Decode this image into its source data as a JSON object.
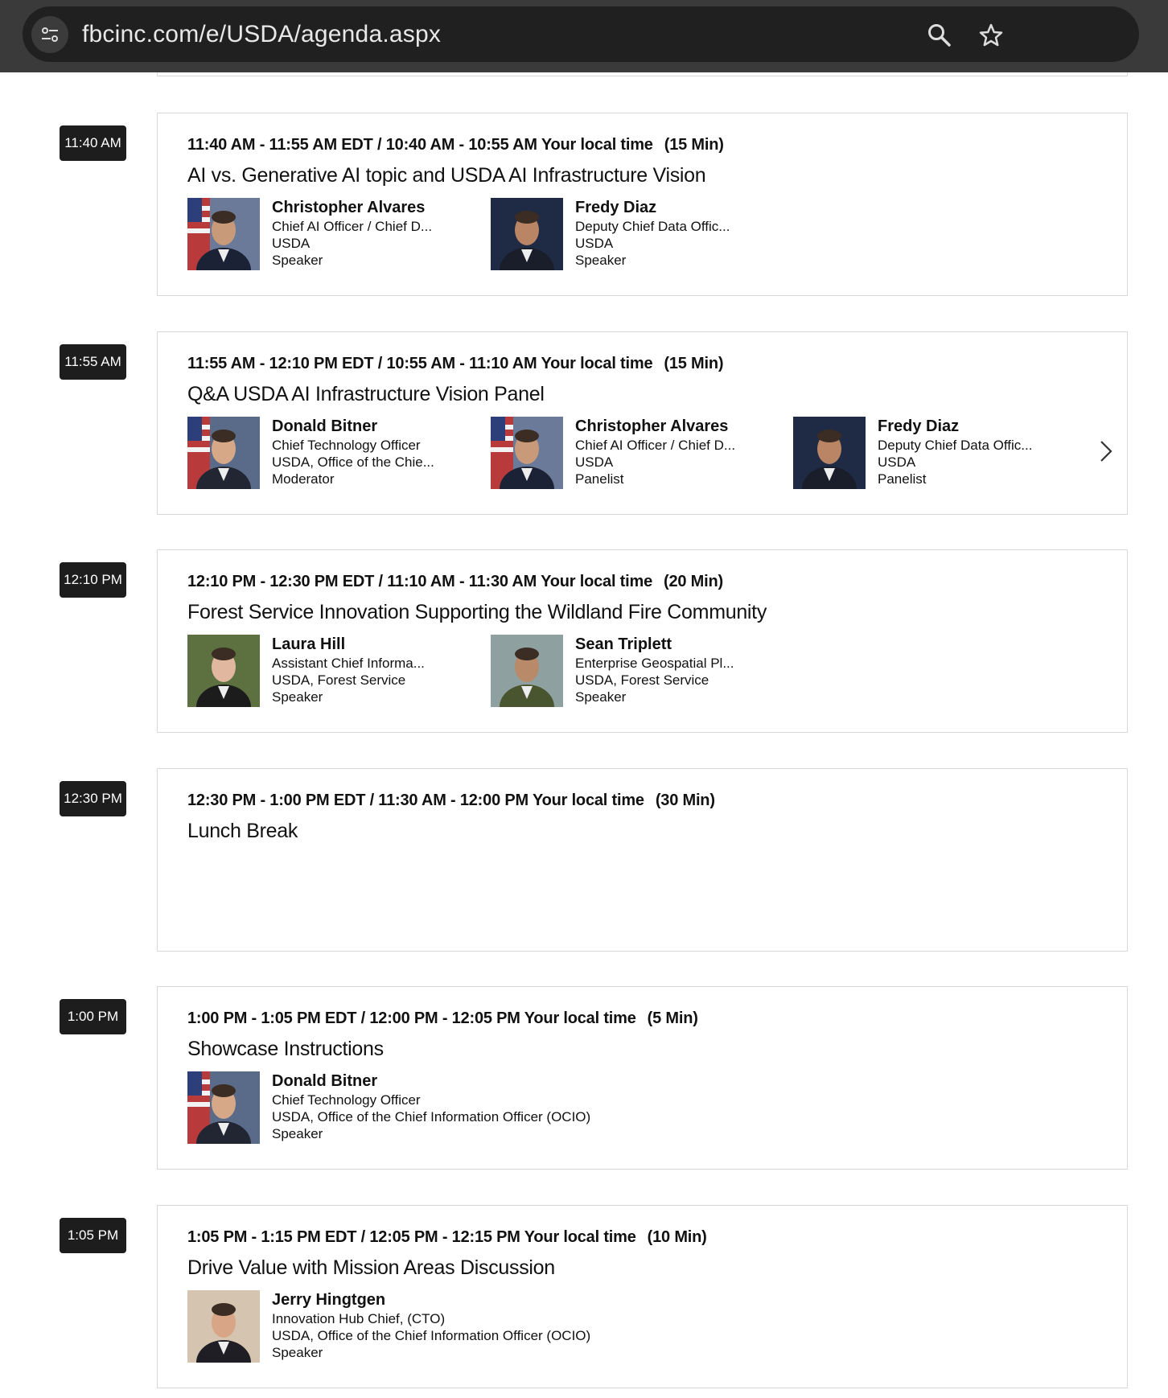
{
  "browser": {
    "url": "fbcinc.com/e/USDA/agenda.aspx",
    "icons": [
      "tune-icon",
      "search-icon",
      "star-icon"
    ]
  },
  "colors": {
    "topbar": "#3a3a3a",
    "urlbar": "#202020",
    "badge": "#1d1d1d",
    "card_border": "#d8d8d8"
  },
  "sessions": [
    {
      "badge": "11:40 AM",
      "time": "11:40 AM - 11:55 AM EDT / 10:40 AM - 10:55 AM Your local time",
      "duration": "(15 Min)",
      "title": "AI vs. Generative AI topic and USDA AI Infrastructure Vision",
      "speakers": [
        {
          "name": "Christopher Alvares",
          "line1": "Chief AI Officer / Chief D...",
          "line2": "USDA",
          "line3": "Speaker"
        },
        {
          "name": "Fredy Diaz",
          "line1": "Deputy Chief Data Offic...",
          "line2": "USDA",
          "line3": "Speaker"
        }
      ]
    },
    {
      "badge": "11:55 AM",
      "time": "11:55 AM - 12:10 PM EDT / 10:55 AM - 11:10 AM Your local time",
      "duration": "(15 Min)",
      "title": "Q&A USDA AI Infrastructure Vision Panel",
      "speakers": [
        {
          "name": "Donald Bitner",
          "line1": "Chief Technology Officer",
          "line2": "USDA, Office of the Chie...",
          "line3": "Moderator"
        },
        {
          "name": "Christopher Alvares",
          "line1": "Chief AI Officer / Chief D...",
          "line2": "USDA",
          "line3": "Panelist"
        },
        {
          "name": "Fredy Diaz",
          "line1": "Deputy Chief Data Offic...",
          "line2": "USDA",
          "line3": "Panelist"
        }
      ]
    },
    {
      "badge": "12:10 PM",
      "time": "12:10 PM - 12:30 PM EDT / 11:10 AM - 11:30 AM Your local time",
      "duration": "(20 Min)",
      "title": "Forest Service Innovation Supporting the Wildland Fire Community",
      "speakers": [
        {
          "name": "Laura Hill",
          "line1": "Assistant Chief Informa...",
          "line2": "USDA, Forest Service",
          "line3": "Speaker"
        },
        {
          "name": "Sean Triplett",
          "line1": "Enterprise Geospatial Pl...",
          "line2": "USDA, Forest Service",
          "line3": "Speaker"
        }
      ]
    },
    {
      "badge": "12:30 PM",
      "time": "12:30 PM - 1:00 PM EDT / 11:30 AM - 12:00 PM Your local time",
      "duration": "(30 Min)",
      "title": "Lunch Break",
      "speakers": []
    },
    {
      "badge": "1:00 PM",
      "time": "1:00 PM - 1:05 PM EDT / 12:00 PM - 12:05 PM Your local time",
      "duration": "(5 Min)",
      "title": "Showcase Instructions",
      "speakers": [
        {
          "name": "Donald Bitner",
          "line1": "Chief Technology Officer",
          "line2": "USDA, Office of the Chief Information Officer (OCIO)",
          "line3": "Speaker"
        }
      ]
    },
    {
      "badge": "1:05 PM",
      "time": "1:05 PM - 1:15 PM EDT / 12:05 PM - 12:15 PM Your local time",
      "duration": "(10 Min)",
      "title": "Drive Value with Mission Areas Discussion",
      "speakers": [
        {
          "name": "Jerry Hingtgen",
          "line1": "Innovation Hub Chief, (CTO)",
          "line2": "USDA, Office of the Chief Information Officer (OCIO)",
          "line3": "Speaker"
        }
      ]
    }
  ]
}
